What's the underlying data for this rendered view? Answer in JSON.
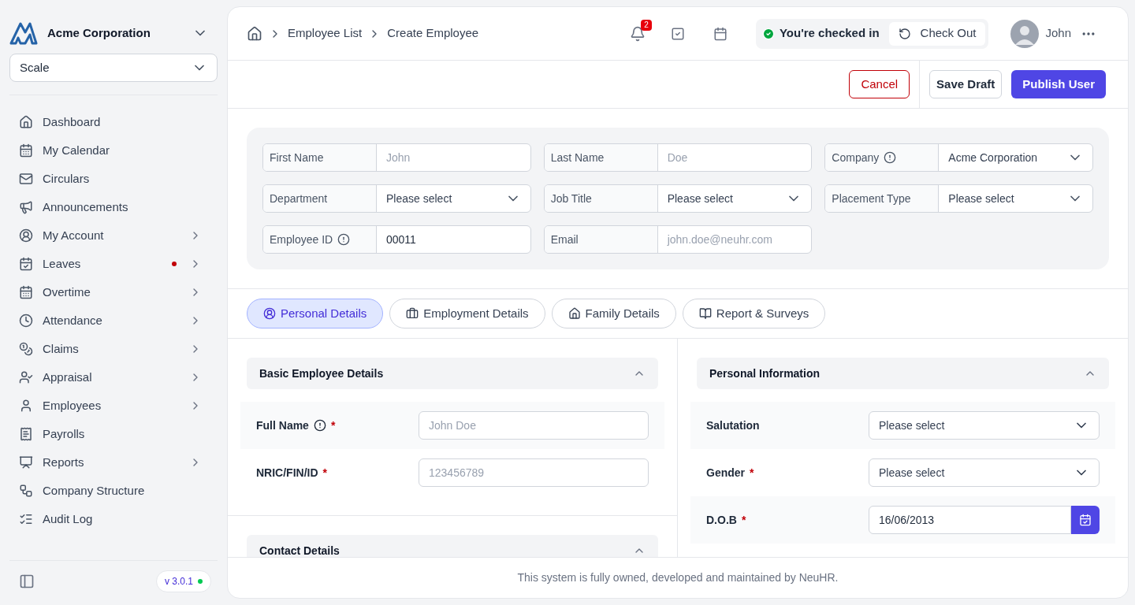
{
  "org": {
    "name": "Acme Corporation",
    "plan": "Scale"
  },
  "sidebar": {
    "items": [
      {
        "label": "Dashboard",
        "submenu": false,
        "alert": false
      },
      {
        "label": "My Calendar",
        "submenu": false,
        "alert": false
      },
      {
        "label": "Circulars",
        "submenu": false,
        "alert": false
      },
      {
        "label": "Announcements",
        "submenu": false,
        "alert": false
      },
      {
        "label": "My Account",
        "submenu": true,
        "alert": false
      },
      {
        "label": "Leaves",
        "submenu": true,
        "alert": true
      },
      {
        "label": "Overtime",
        "submenu": true,
        "alert": false
      },
      {
        "label": "Attendance",
        "submenu": true,
        "alert": false
      },
      {
        "label": "Claims",
        "submenu": true,
        "alert": false
      },
      {
        "label": "Appraisal",
        "submenu": true,
        "alert": false
      },
      {
        "label": "Employees",
        "submenu": true,
        "alert": false
      },
      {
        "label": "Payrolls",
        "submenu": false,
        "alert": false
      },
      {
        "label": "Reports",
        "submenu": true,
        "alert": false
      },
      {
        "label": "Company Structure",
        "submenu": false,
        "alert": false
      },
      {
        "label": "Audit Log",
        "submenu": false,
        "alert": false
      }
    ],
    "version": "v 3.0.1"
  },
  "breadcrumb": [
    "Employee List",
    "Create Employee"
  ],
  "header": {
    "notifications": "2",
    "status": "You're checked in",
    "check_out": "Check Out",
    "user": "John"
  },
  "actions": {
    "cancel": "Cancel",
    "save": "Save Draft",
    "publish": "Publish User"
  },
  "top_fields": [
    {
      "label": "First Name",
      "kind": "text",
      "placeholder": "John",
      "info": false
    },
    {
      "label": "Last Name",
      "kind": "text",
      "placeholder": "Doe",
      "info": false
    },
    {
      "label": "Company",
      "kind": "select",
      "value": "Acme Corporation",
      "info": true
    },
    {
      "label": "Department",
      "kind": "select",
      "value": "Please select",
      "info": false
    },
    {
      "label": "Job Title",
      "kind": "select",
      "value": "Please select",
      "info": false
    },
    {
      "label": "Placement Type",
      "kind": "select",
      "value": "Please select",
      "info": false
    },
    {
      "label": "Employee ID",
      "kind": "text",
      "value": "00011",
      "info": true
    },
    {
      "label": "Email",
      "kind": "text",
      "placeholder": "john.doe@neuhr.com",
      "info": false
    }
  ],
  "tabs": [
    {
      "label": "Personal Details",
      "selected": true
    },
    {
      "label": "Employment Details",
      "selected": false
    },
    {
      "label": "Family Details",
      "selected": false
    },
    {
      "label": "Report & Surveys",
      "selected": false
    }
  ],
  "sections_left": [
    {
      "title": "Basic Employee Details",
      "expanded": true,
      "fields": [
        {
          "label": "Full Name",
          "kind": "text",
          "placeholder": "John Doe",
          "required_mark": "*",
          "info": true
        },
        {
          "label": "NRIC/FIN/ID",
          "kind": "text",
          "placeholder": "123456789",
          "required_mark": "*",
          "info": false
        }
      ]
    },
    {
      "title": "Contact Details",
      "expanded": true
    }
  ],
  "sections_right": [
    {
      "title": "Personal Information",
      "expanded": true,
      "fields": [
        {
          "label": "Salutation",
          "kind": "select",
          "value": "Please select",
          "info": false
        },
        {
          "label": "Gender",
          "kind": "select",
          "value": "Please select",
          "required_mark": "*",
          "info": false
        },
        {
          "label": "D.O.B",
          "kind": "date",
          "value": "16/06/2013",
          "required_mark": "*",
          "info": false
        }
      ]
    }
  ],
  "footer": "This system is fully owned, developed and maintained by NeuHR."
}
